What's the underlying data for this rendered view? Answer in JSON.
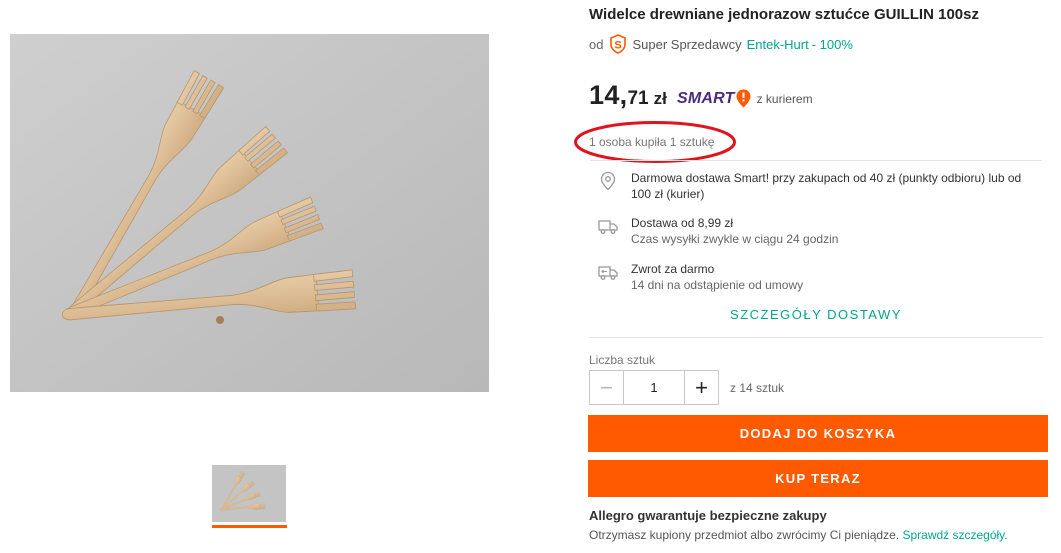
{
  "product": {
    "title": "Widelce drewniane jednorazow sztućce GUILLIN 100sz",
    "image_alt": "wooden forks"
  },
  "seller": {
    "prefix": "od",
    "badge_letter": "S",
    "super_label": "Super Sprzedawcy",
    "name": "Entek-Hurt",
    "rating": "- 100%"
  },
  "price": {
    "whole": "14,",
    "fraction": "71",
    "currency": "zł",
    "smart_label": "SMART",
    "delivery_note": "z kurierem"
  },
  "bought_info": "1 osoba kupiła 1 sztukę",
  "delivery": {
    "items": [
      {
        "icon": "location-pin-icon",
        "title": "Darmowa dostawa Smart! przy zakupach od 40 zł (punkty odbioru) lub od 100 zł (kurier)",
        "subtitle": ""
      },
      {
        "icon": "truck-icon",
        "title": "Dostawa od 8,99 zł",
        "subtitle": "Czas wysyłki zwykle w ciągu 24 godzin"
      },
      {
        "icon": "return-truck-icon",
        "title": "Zwrot za darmo",
        "subtitle": "14 dni na odstąpienie od umowy"
      }
    ],
    "details_link": "SZCZEGÓŁY DOSTAWY"
  },
  "quantity": {
    "label": "Liczba sztuk",
    "minus": "−",
    "value": "1",
    "plus": "+",
    "available": "z 14 sztuk"
  },
  "actions": {
    "add_to_cart": "DODAJ DO KOSZYKA",
    "buy_now": "KUP TERAZ"
  },
  "guarantee": {
    "title": "Allegro gwarantuje bezpieczne zakupy",
    "text": "Otrzymasz kupiony przedmiot albo zwrócimy Ci pieniądze.",
    "link": "Sprawdź szczegóły."
  },
  "colors": {
    "accent": "#ff5a00",
    "link": "#00a790",
    "smart": "#4a2b7f",
    "annotation": "#e0141e"
  }
}
